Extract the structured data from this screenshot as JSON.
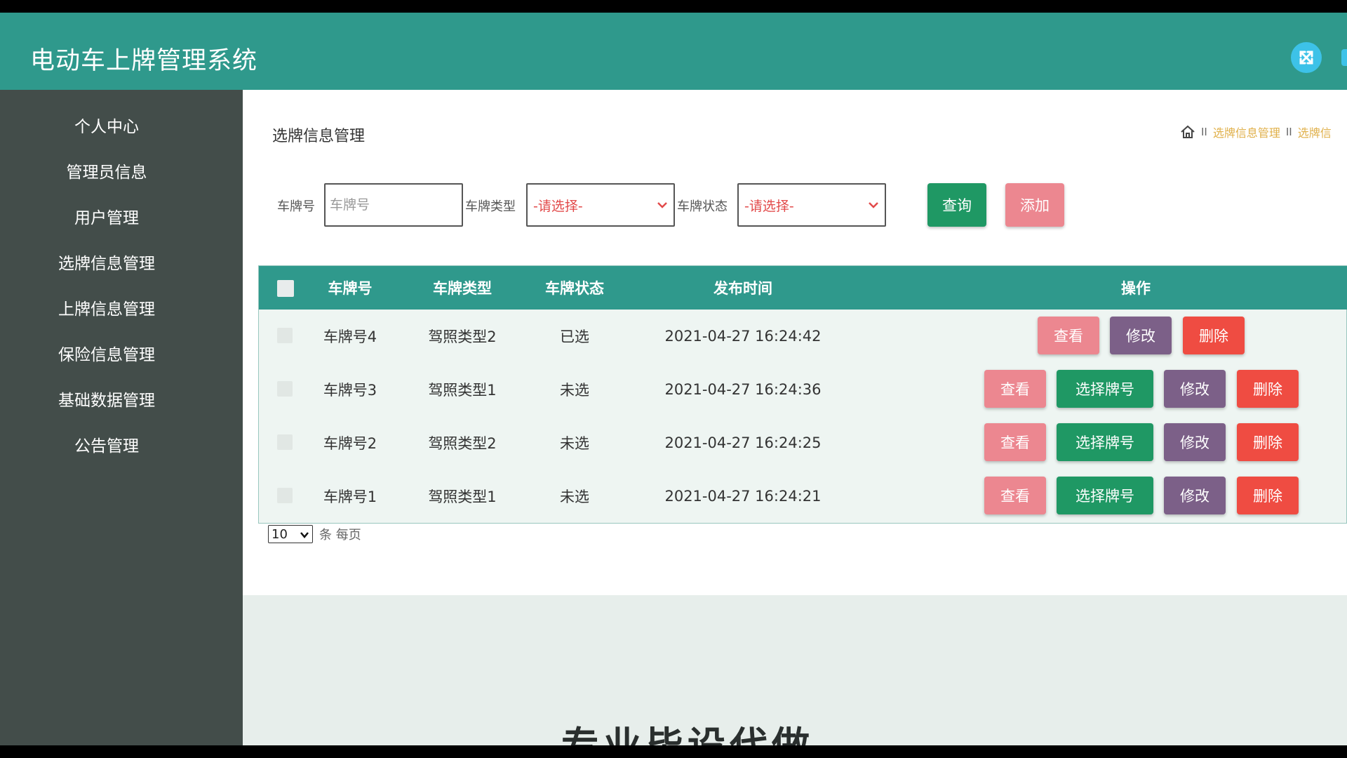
{
  "header": {
    "title": "电动车上牌管理系统"
  },
  "sidebar": {
    "items": [
      {
        "label": "个人中心"
      },
      {
        "label": "管理员信息"
      },
      {
        "label": "用户管理"
      },
      {
        "label": "选牌信息管理"
      },
      {
        "label": "上牌信息管理"
      },
      {
        "label": "保险信息管理"
      },
      {
        "label": "基础数据管理"
      },
      {
        "label": "公告管理"
      }
    ]
  },
  "main": {
    "page_title": "选牌信息管理",
    "breadcrumb": {
      "sep": "II",
      "items": [
        "选牌信息管理",
        "选牌信"
      ]
    }
  },
  "search": {
    "plate_label": "车牌号",
    "plate_placeholder": "车牌号",
    "type_label": "车牌类型",
    "type_selected": "-请选择-",
    "status_label": "车牌状态",
    "status_selected": "-请选择-",
    "query_label": "查询",
    "add_label": "添加"
  },
  "table": {
    "headers": {
      "plate": "车牌号",
      "type": "车牌类型",
      "status": "车牌状态",
      "time": "发布时间",
      "actions": "操作"
    },
    "rows": [
      {
        "plate": "车牌号4",
        "type": "驾照类型2",
        "status": "已选",
        "time": "2021-04-27 16:24:42"
      },
      {
        "plate": "车牌号3",
        "type": "驾照类型1",
        "status": "未选",
        "time": "2021-04-27 16:24:36"
      },
      {
        "plate": "车牌号2",
        "type": "驾照类型2",
        "status": "未选",
        "time": "2021-04-27 16:24:25"
      },
      {
        "plate": "车牌号1",
        "type": "驾照类型1",
        "status": "未选",
        "time": "2021-04-27 16:24:21"
      }
    ],
    "actions": {
      "view": "查看",
      "select": "选择牌号",
      "edit": "修改",
      "delete": "删除"
    }
  },
  "pagination": {
    "page_size": "10",
    "per_page_text": "条 每页"
  },
  "watermark": "专业毕设代做",
  "colors": {
    "header": "#2f998c",
    "sidebar": "#434d4a",
    "query": "#1f9864",
    "add": "#ec8790",
    "edit": "#7c6088",
    "delete": "#ef4c42"
  },
  "icons": {
    "fullscreen": "fullscreen-icon",
    "home": "home-icon"
  }
}
